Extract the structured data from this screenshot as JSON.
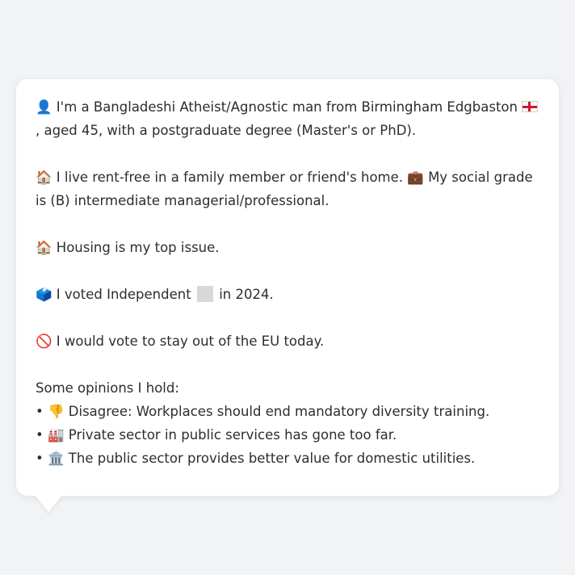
{
  "intro": {
    "person_icon": "👤",
    "text_before_flag": "I'm a Bangladeshi Atheist/Agnostic man from Birmingham Edgbaston",
    "flag_icon": "england-flag-icon",
    "text_after_flag": ", aged 45, with a postgraduate degree (Master's or PhD)."
  },
  "home": {
    "house_icon": "🏠",
    "text": "I live rent-free in a family member or friend's home.",
    "briefcase_icon": "💼",
    "grade_text": "My social grade is (B) intermediate managerial/professional."
  },
  "issue": {
    "icon": "🏠",
    "text": "Housing is my top issue."
  },
  "vote": {
    "icon": "🗳️",
    "text_before": "I voted Independent",
    "party_icon": "blank-party-icon",
    "text_after": "in 2024."
  },
  "eu": {
    "icon": "🚫",
    "text": "I would vote to stay out of the EU today."
  },
  "opinions": {
    "heading": "Some opinions I hold:",
    "items": [
      {
        "icon": "👎",
        "text": "Disagree: Workplaces should end mandatory diversity training."
      },
      {
        "icon": "🏭",
        "text": "Private sector in public services has gone too far."
      },
      {
        "icon": "🏛️",
        "text": "The public sector provides better value for domestic utilities."
      }
    ]
  }
}
